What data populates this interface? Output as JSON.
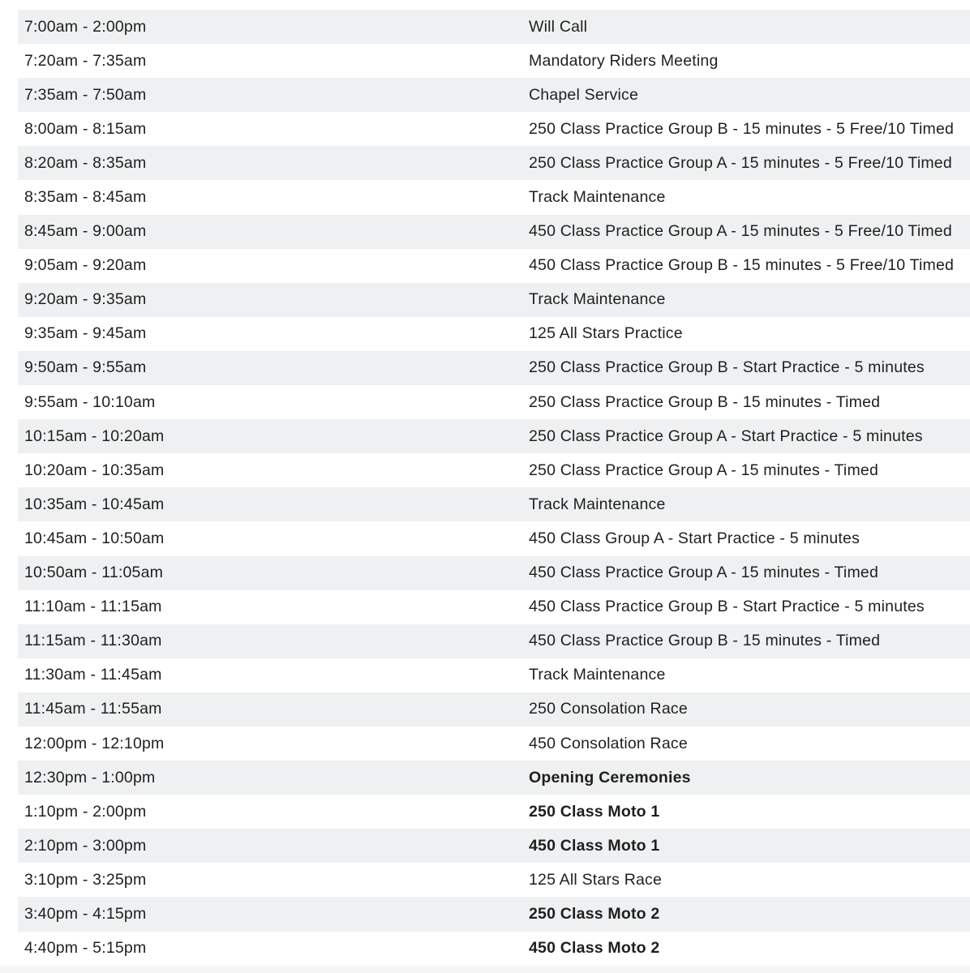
{
  "schedule": {
    "rows": [
      {
        "time": "7:00am - 2:00pm",
        "event": "Will Call",
        "bold": false
      },
      {
        "time": "7:20am - 7:35am",
        "event": "Mandatory Riders Meeting",
        "bold": false
      },
      {
        "time": "7:35am - 7:50am",
        "event": "Chapel Service",
        "bold": false
      },
      {
        "time": "8:00am - 8:15am",
        "event": "250 Class Practice Group B - 15 minutes - 5 Free/10 Timed",
        "bold": false
      },
      {
        "time": "8:20am - 8:35am",
        "event": "250 Class Practice Group A - 15 minutes - 5 Free/10 Timed",
        "bold": false
      },
      {
        "time": "8:35am - 8:45am",
        "event": "Track Maintenance",
        "bold": false
      },
      {
        "time": "8:45am - 9:00am",
        "event": "450 Class Practice Group A - 15 minutes - 5 Free/10 Timed",
        "bold": false
      },
      {
        "time": "9:05am - 9:20am",
        "event": "450 Class Practice Group B - 15 minutes - 5 Free/10 Timed",
        "bold": false
      },
      {
        "time": "9:20am - 9:35am",
        "event": "Track Maintenance",
        "bold": false
      },
      {
        "time": "9:35am - 9:45am",
        "event": "125 All Stars Practice",
        "bold": false
      },
      {
        "time": "9:50am - 9:55am",
        "event": "250 Class Practice Group B - Start Practice - 5 minutes",
        "bold": false
      },
      {
        "time": "9:55am - 10:10am",
        "event": "250 Class Practice Group B - 15 minutes - Timed",
        "bold": false
      },
      {
        "time": "10:15am - 10:20am",
        "event": "250 Class Practice Group A - Start Practice - 5 minutes",
        "bold": false
      },
      {
        "time": "10:20am - 10:35am",
        "event": "250 Class Practice Group A - 15 minutes - Timed",
        "bold": false
      },
      {
        "time": "10:35am - 10:45am",
        "event": "Track Maintenance",
        "bold": false
      },
      {
        "time": "10:45am - 10:50am",
        "event": "450 Class Group A - Start Practice - 5 minutes",
        "bold": false
      },
      {
        "time": "10:50am - 11:05am",
        "event": "450 Class Practice Group A - 15 minutes - Timed",
        "bold": false
      },
      {
        "time": "11:10am - 11:15am",
        "event": "450 Class Practice Group B - Start Practice - 5 minutes",
        "bold": false
      },
      {
        "time": "11:15am - 11:30am",
        "event": "450 Class Practice Group B - 15 minutes - Timed",
        "bold": false
      },
      {
        "time": "11:30am - 11:45am",
        "event": "Track Maintenance",
        "bold": false
      },
      {
        "time": "11:45am - 11:55am",
        "event": "250 Consolation Race",
        "bold": false
      },
      {
        "time": "12:00pm - 12:10pm",
        "event": "450 Consolation Race",
        "bold": false
      },
      {
        "time": "12:30pm - 1:00pm",
        "event": "Opening Ceremonies",
        "bold": true
      },
      {
        "time": "1:10pm - 2:00pm",
        "event": "250 Class Moto 1",
        "bold": true
      },
      {
        "time": "2:10pm - 3:00pm",
        "event": "450 Class Moto 1",
        "bold": true
      },
      {
        "time": "3:10pm - 3:25pm",
        "event": "125 All Stars Race",
        "bold": false
      },
      {
        "time": "3:40pm - 4:15pm",
        "event": "250 Class Moto 2",
        "bold": true
      },
      {
        "time": "4:40pm - 5:15pm",
        "event": "450 Class Moto 2",
        "bold": true
      }
    ]
  },
  "colors": {
    "row_stripe": "#eff0f1",
    "row_plain": "#ffffff",
    "text": "#1f1f1f"
  }
}
